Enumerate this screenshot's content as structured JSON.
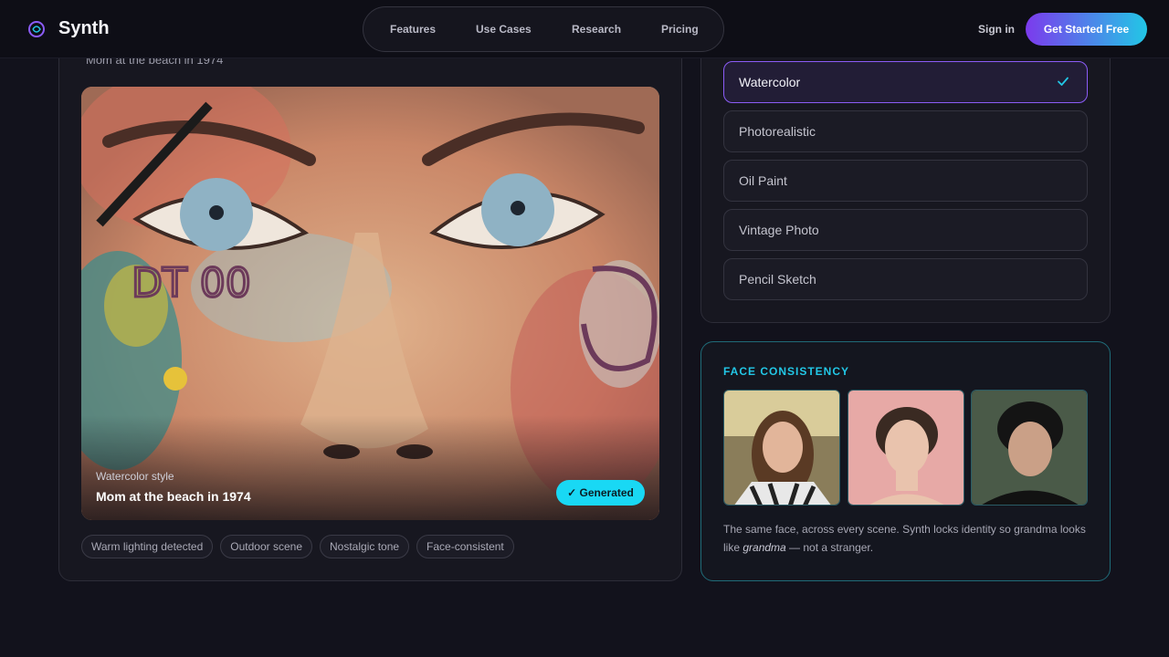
{
  "nav": {
    "brand": "Synth",
    "links": [
      "Features",
      "Use Cases",
      "Research",
      "Pricing"
    ],
    "sign_in": "Sign in",
    "cta": "Get Started Free"
  },
  "preview": {
    "caption": "Mom at the beach in 1974",
    "style_label": "Watercolor style",
    "title": "Mom at the beach in 1974",
    "badge": "✓ Generated",
    "tags": [
      "Warm lighting detected",
      "Outdoor scene",
      "Nostalgic tone",
      "Face-consistent"
    ]
  },
  "styles": {
    "options": [
      "Watercolor",
      "Photorealistic",
      "Oil Paint",
      "Vintage Photo",
      "Pencil Sketch"
    ],
    "selected": "Watercolor"
  },
  "face_consistency": {
    "heading": "FACE CONSISTENCY",
    "desc_before": "The same face, across every scene. Synth locks identity so grandma looks like ",
    "desc_em": "grandma",
    "desc_after": " — not a stranger.",
    "faces": [
      "portrait-woman-striped-shirt",
      "portrait-woman-pink-background",
      "portrait-young-man-dark-hair"
    ]
  },
  "colors": {
    "accent_purple": "#7c3aed",
    "accent_cyan": "#22c7e6",
    "background": "#12121c"
  }
}
